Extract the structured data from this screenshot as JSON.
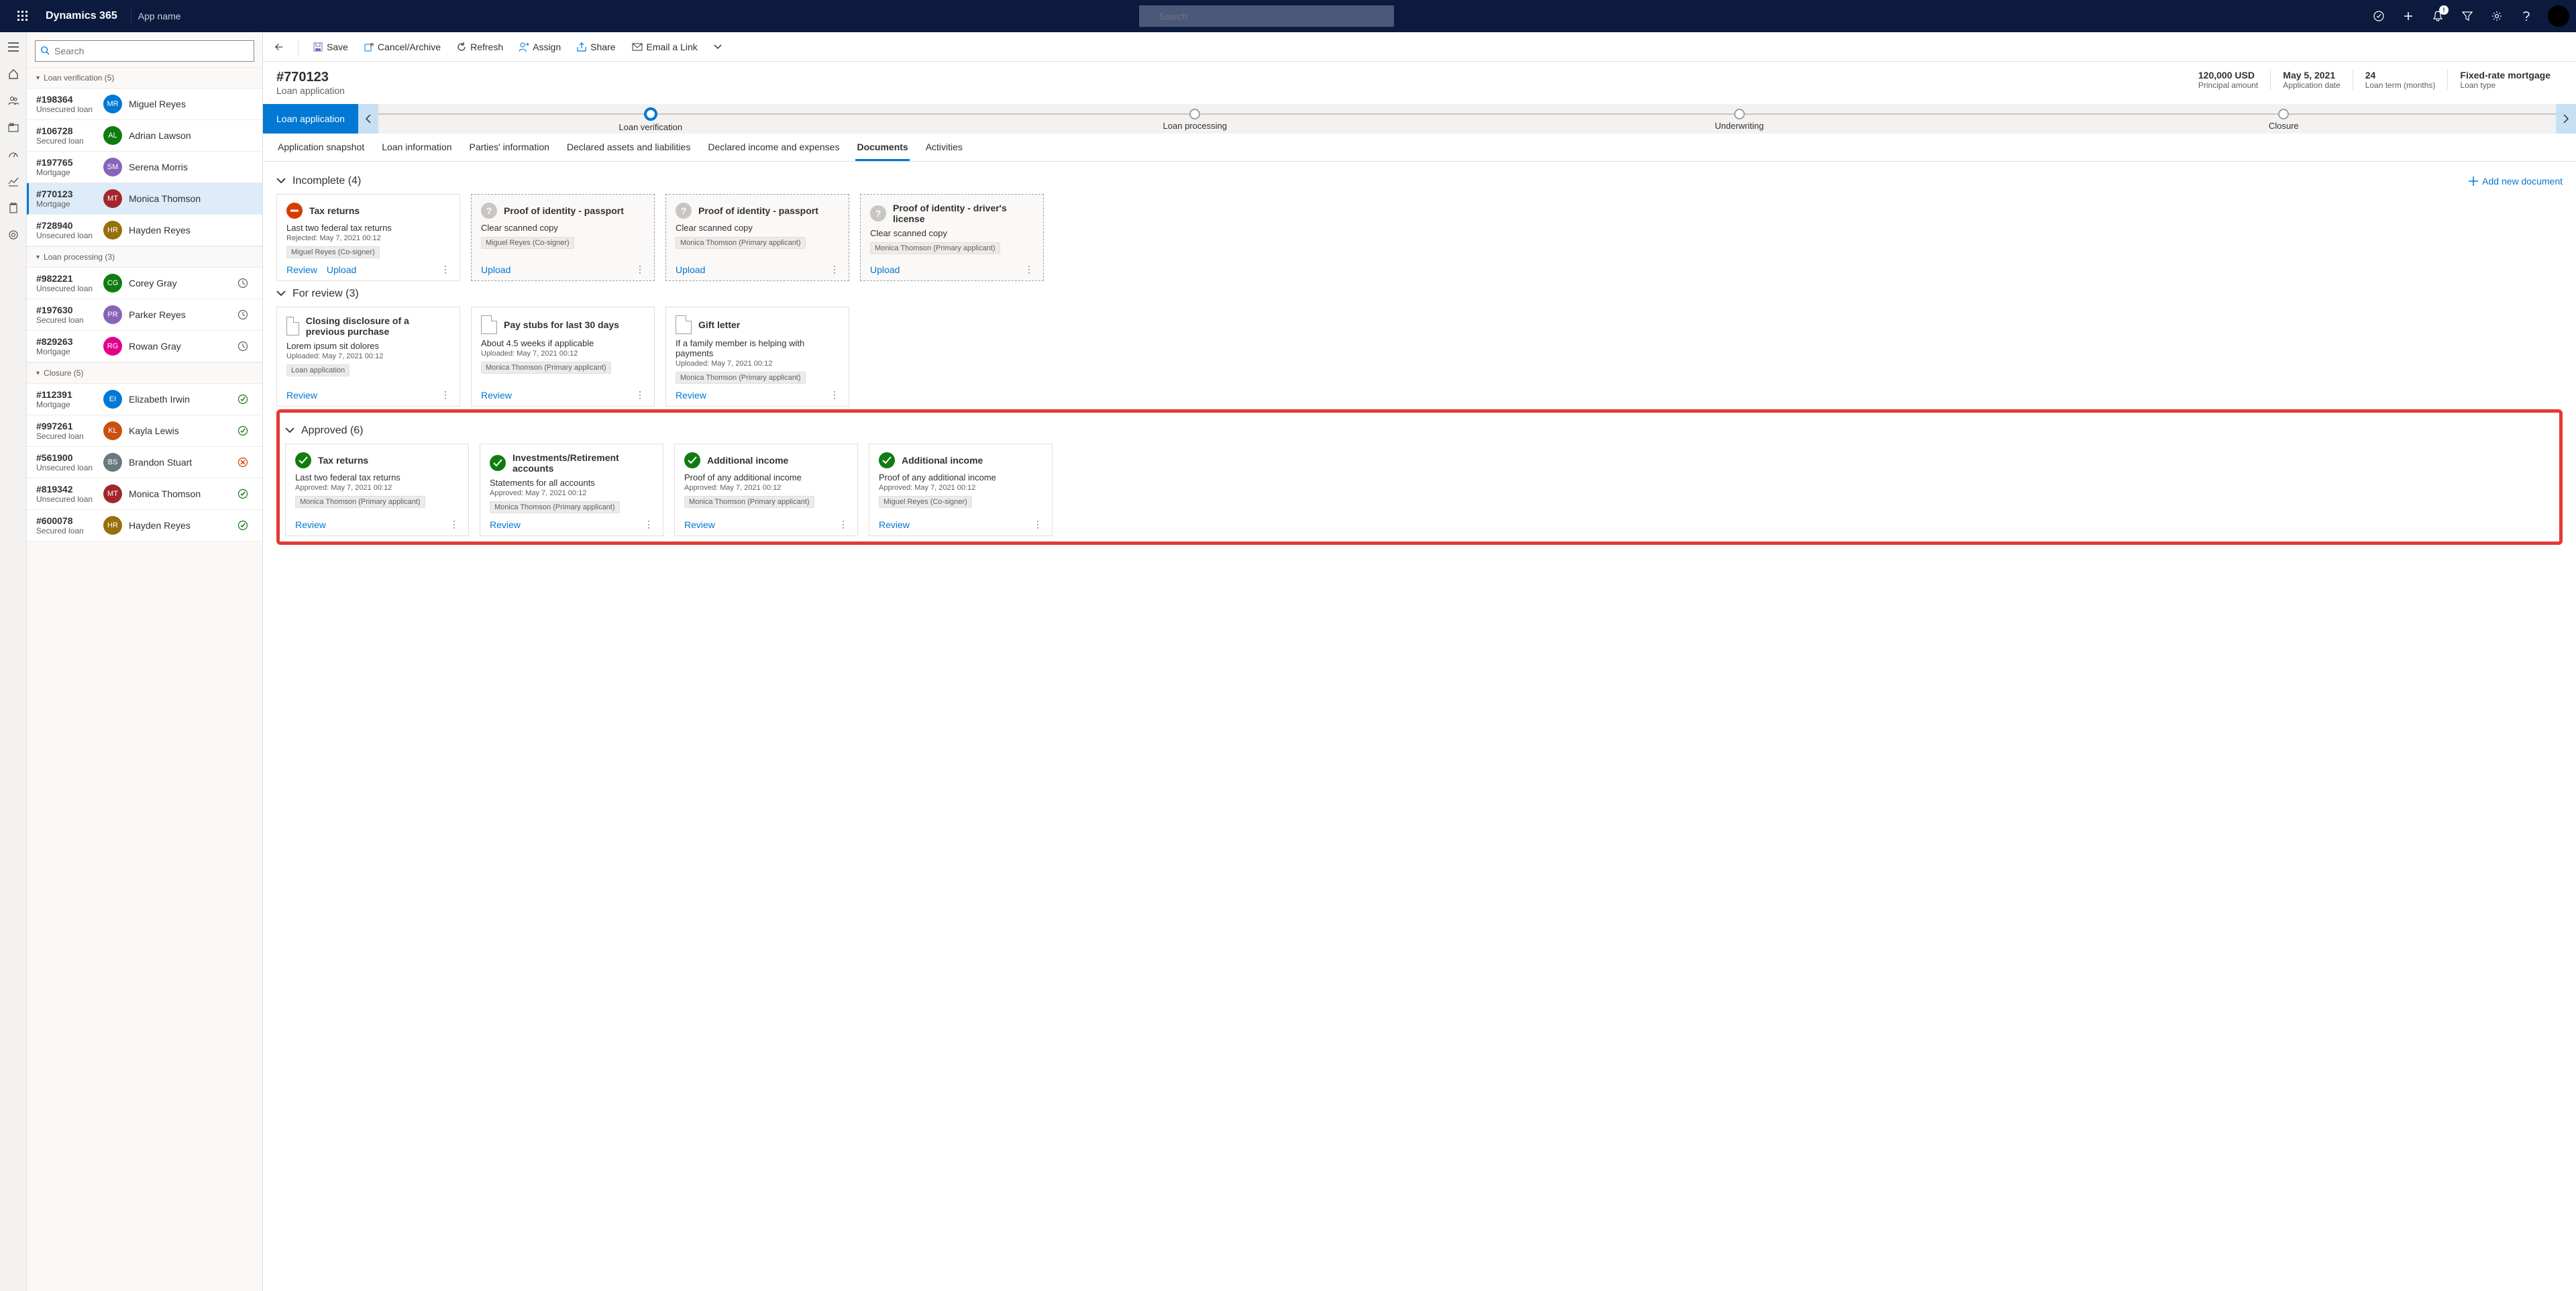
{
  "topbar": {
    "brand": "Dynamics 365",
    "appname": "App name",
    "search_placeholder": "Search",
    "notif_count": "!"
  },
  "list": {
    "search_placeholder": "Search",
    "groups": [
      {
        "label": "Loan verification (5)"
      },
      {
        "label": "Loan processing (3)"
      },
      {
        "label": "Closure (5)"
      }
    ],
    "verification": [
      {
        "id": "#198364",
        "sub": "Unsecured loan",
        "name": "Miguel Reyes",
        "initials": "MR",
        "color": "#0078d4"
      },
      {
        "id": "#106728",
        "sub": "Secured loan",
        "name": "Adrian Lawson",
        "initials": "AL",
        "color": "#107c10"
      },
      {
        "id": "#197765",
        "sub": "Mortgage",
        "name": "Serena Morris",
        "initials": "SM",
        "color": "#8764b8"
      },
      {
        "id": "#770123",
        "sub": "Mortgage",
        "name": "Monica Thomson",
        "initials": "MT",
        "color": "#a4262c",
        "selected": true
      },
      {
        "id": "#728940",
        "sub": "Unsecured loan",
        "name": "Hayden Reyes",
        "initials": "HR",
        "color": "#986f0b"
      }
    ],
    "processing": [
      {
        "id": "#982221",
        "sub": "Unsecured loan",
        "name": "Corey Gray",
        "initials": "CG",
        "color": "#107c10",
        "status": "wait"
      },
      {
        "id": "#197630",
        "sub": "Secured loan",
        "name": "Parker Reyes",
        "initials": "PR",
        "color": "#8764b8",
        "status": "wait"
      },
      {
        "id": "#829263",
        "sub": "Mortgage",
        "name": "Rowan Gray",
        "initials": "RG",
        "color": "#e3008c",
        "status": "wait"
      }
    ],
    "closure": [
      {
        "id": "#112391",
        "sub": "Mortgage",
        "name": "Elizabeth Irwin",
        "initials": "EI",
        "color": "#0078d4",
        "status": "ok"
      },
      {
        "id": "#997261",
        "sub": "Secured loan",
        "name": "Kayla Lewis",
        "initials": "KL",
        "color": "#ca5010",
        "status": "ok"
      },
      {
        "id": "#561900",
        "sub": "Unsecured loan",
        "name": "Brandon Stuart",
        "initials": "BS",
        "color": "#69797e",
        "status": "bad"
      },
      {
        "id": "#819342",
        "sub": "Unsecured loan",
        "name": "Monica Thomson",
        "initials": "MT",
        "color": "#a4262c",
        "status": "ok"
      },
      {
        "id": "#600078",
        "sub": "Secured loan",
        "name": "Hayden Reyes",
        "initials": "HR",
        "color": "#986f0b",
        "status": "ok"
      }
    ]
  },
  "cmdbar": {
    "save": "Save",
    "cancel": "Cancel/Archive",
    "refresh": "Refresh",
    "assign": "Assign",
    "share": "Share",
    "email": "Email a Link"
  },
  "header": {
    "title": "#770123",
    "subtitle": "Loan application",
    "f1v": "120,000 USD",
    "f1l": "Principal amount",
    "f2v": "May 5, 2021",
    "f2l": "Application date",
    "f3v": "24",
    "f3l": "Loan term (months)",
    "f4v": "Fixed-rate mortgage",
    "f4l": "Loan type"
  },
  "stages": {
    "current": "Loan application",
    "s1": "Loan verification",
    "s2": "Loan processing",
    "s3": "Underwriting",
    "s4": "Closure"
  },
  "tabs": {
    "t1": "Application snapshot",
    "t2": "Loan information",
    "t3": "Parties' information",
    "t4": "Declared assets and liabilities",
    "t5": "Declared income and expenses",
    "t6": "Documents",
    "t7": "Activities"
  },
  "sections": {
    "incomplete": "Incomplete (4)",
    "forreview": "For review  (3)",
    "approved": "Approved (6)",
    "addnew": "Add new document"
  },
  "actions": {
    "review": "Review",
    "upload": "Upload"
  },
  "incomplete": [
    {
      "title": "Tax returns",
      "desc": "Last two federal tax returns",
      "meta": "Rejected: May 7, 2021   00:12",
      "tag": "Miguel Reyes  (Co-signer)",
      "icon": "reject",
      "actions": [
        "review",
        "upload"
      ]
    },
    {
      "title": "Proof of identity - passport",
      "desc": "Clear scanned copy",
      "meta": "",
      "tag": "Miguel Reyes  (Co-signer)",
      "icon": "q",
      "dashed": true,
      "actions": [
        "upload"
      ]
    },
    {
      "title": "Proof of identity - passport",
      "desc": "Clear scanned copy",
      "meta": "",
      "tag": "Monica Thomson (Primary applicant)",
      "icon": "q",
      "dashed": true,
      "actions": [
        "upload"
      ]
    },
    {
      "title": "Proof of identity - driver's license",
      "desc": "Clear scanned copy",
      "meta": "",
      "tag": "Monica Thomson (Primary applicant)",
      "icon": "q",
      "dashed": true,
      "actions": [
        "upload"
      ]
    }
  ],
  "forreview": [
    {
      "title": "Closing disclosure of a previous purchase",
      "desc": "Lorem ipsum sit dolores",
      "meta": "Uploaded: May 7, 2021   00:12",
      "tag": "Loan application"
    },
    {
      "title": "Pay stubs for last 30 days",
      "desc": "About 4.5 weeks if applicable",
      "meta": "Uploaded: May 7, 2021   00:12",
      "tag": "Monica Thomson (Primary applicant)"
    },
    {
      "title": "Gift letter",
      "desc": "If a family member is helping with payments",
      "meta": "Uploaded: May 7, 2021   00:12",
      "tag": "Monica Thomson (Primary applicant)"
    }
  ],
  "approved": [
    {
      "title": "Tax returns",
      "desc": "Last two federal tax returns",
      "meta": "Approved: May 7, 2021   00:12",
      "tag": "Monica Thomson (Primary applicant)"
    },
    {
      "title": "Investments/Retirement accounts",
      "desc": "Statements for all accounts",
      "meta": "Approved: May 7, 2021   00:12",
      "tag": "Monica Thomson (Primary applicant)"
    },
    {
      "title": "Additional income",
      "desc": "Proof of any additional income",
      "meta": "Approved: May 7, 2021   00:12",
      "tag": "Monica Thomson (Primary applicant)"
    },
    {
      "title": "Additional income",
      "desc": "Proof of any additional income",
      "meta": "Approved: May 7, 2021   00:12",
      "tag": "Miguel Reyes  (Co-signer)"
    }
  ]
}
